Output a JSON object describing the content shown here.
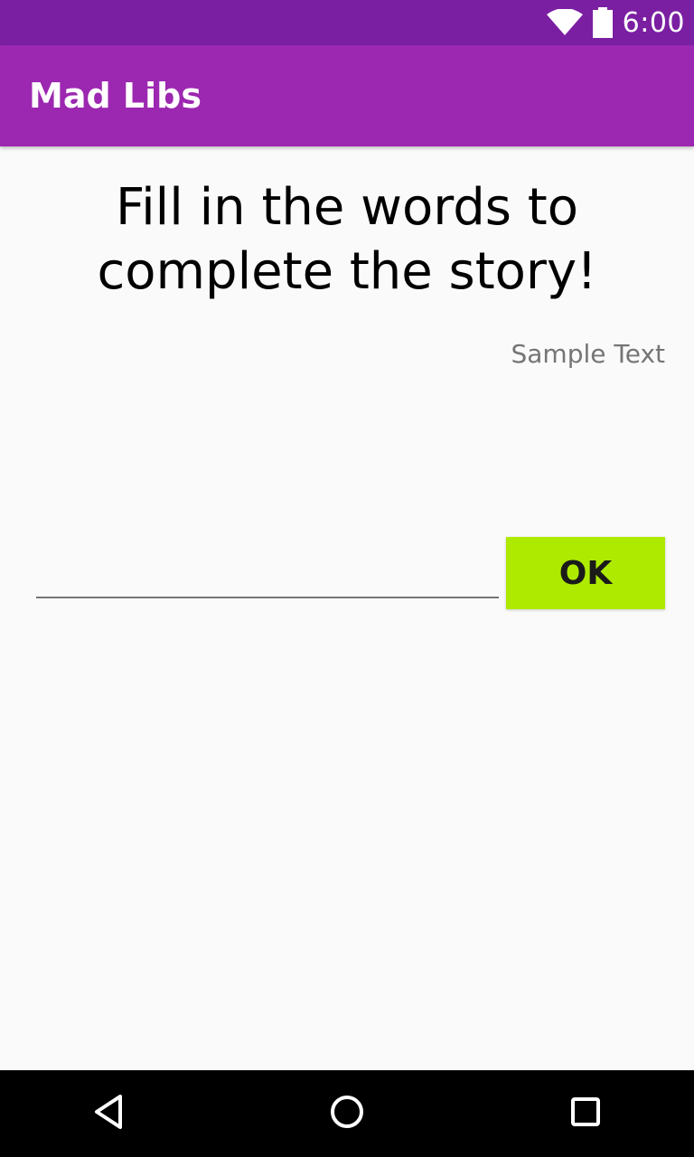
{
  "status_bar": {
    "time": "6:00",
    "icons": [
      "wifi-icon",
      "battery-icon"
    ],
    "color": "#7b1fa2"
  },
  "app_bar": {
    "title": "Mad Libs",
    "color": "#9c27b0"
  },
  "main": {
    "headline": "Fill in the words to complete the story!",
    "sample_text": "Sample Text",
    "word_input": {
      "value": "",
      "placeholder": ""
    },
    "ok_button": {
      "label": "OK",
      "color": "#aeea00"
    }
  },
  "nav_bar": {
    "icons": [
      "back-icon",
      "home-icon",
      "recents-icon"
    ]
  }
}
